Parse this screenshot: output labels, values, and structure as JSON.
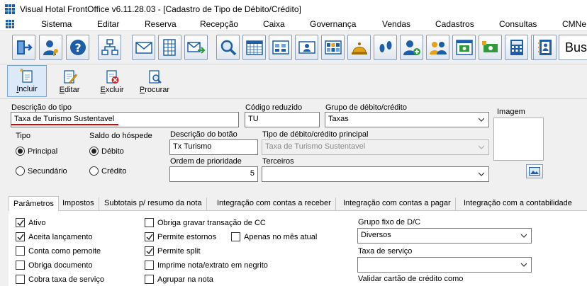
{
  "window": {
    "title": "Visual Hotal FrontOffice v6.11.28.03 - [Cadastro de Tipo de Débito/Crédito]"
  },
  "menu": [
    "Sistema",
    "Editar",
    "Reserva",
    "Recepção",
    "Caixa",
    "Governança",
    "Vendas",
    "Cadastros",
    "Consultas",
    "CMNe"
  ],
  "toolbar": {
    "icons": [
      "exit-door-icon",
      "user-key-icon",
      "help-icon",
      "org-chart-icon",
      "envelope-icon",
      "spreadsheet-icon",
      "mail-forward-icon",
      "magnifier-icon",
      "calendar-grid-icon",
      "room-map-icon",
      "guest-card-icon",
      "room-board-icon",
      "bell-icon",
      "footprints-icon",
      "add-guest-icon",
      "group-icon",
      "cash-register-window-icon",
      "payment-icon",
      "calculator-icon",
      "maid-icon",
      "address-book-icon"
    ],
    "search_value": "Bus"
  },
  "actions": {
    "incluir": "ncluir",
    "incluir_key": "I",
    "editar": "ditar",
    "editar_key": "E",
    "excluir": "xcluir",
    "excluir_key": "E",
    "procurar": "rocurar",
    "procurar_key": "P"
  },
  "form": {
    "descricao_label": "Descrição do tipo",
    "descricao_value": "Taxa de Turismo Sustentavel",
    "codigo_label": "Código reduzido",
    "codigo_value": "TU",
    "grupo_label": "Grupo de débito/crédito",
    "grupo_value": "Taxas",
    "imagem_label": "Imagem",
    "tipo_label": "Tipo",
    "tipo_principal": "Principal",
    "tipo_secundario": "Secundário",
    "saldo_label": "Saldo do hóspede",
    "saldo_debito": "Débito",
    "saldo_credito": "Crédito",
    "descricao_botao_label": "Descrição do botão",
    "descricao_botao_value": "Tx Turismo",
    "tipo_principal_label": "Tipo de débito/crédito principal",
    "tipo_principal_value": "Taxa de Turismo Sustentavel",
    "ordem_label": "Ordem de prioridade",
    "ordem_value": "5",
    "terceiros_label": "Terceiros",
    "terceiros_value": ""
  },
  "tabs": [
    "Parâmetros",
    "Impostos",
    "Subtotais p/ resumo da nota",
    "Integração com contas a receber",
    "Integração com contas a pagar",
    "Integração com a contabilidade"
  ],
  "params": {
    "col1": [
      {
        "label": "Ativo",
        "checked": true
      },
      {
        "label": "Aceita lançamento",
        "checked": true
      },
      {
        "label": "Conta como pernoite",
        "checked": false
      },
      {
        "label": "Obriga documento",
        "checked": false
      },
      {
        "label": "Cobra taxa de serviço",
        "checked": false
      }
    ],
    "col2": [
      {
        "label": "Obriga gravar transação de CC",
        "checked": false
      },
      {
        "label": "Permite estornos",
        "checked": true
      },
      {
        "label": "Permite split",
        "checked": true
      },
      {
        "label": "Imprime nota/extrato em negrito",
        "checked": false
      },
      {
        "label": "Agrupar na nota",
        "checked": false
      }
    ],
    "apenas_mes": {
      "label": "Apenas no mês atual",
      "checked": false
    },
    "grupo_fixo_label": "Grupo fixo de D/C",
    "grupo_fixo_value": "Diversos",
    "taxa_servico_label": "Taxa de serviço",
    "taxa_servico_value": "",
    "validar_label": "Validar cartão de crédito como"
  },
  "colors": {
    "accent_blue": "#1c5fa8",
    "required_underline": "#e00000",
    "active_tab_bg": "#ffffff"
  }
}
